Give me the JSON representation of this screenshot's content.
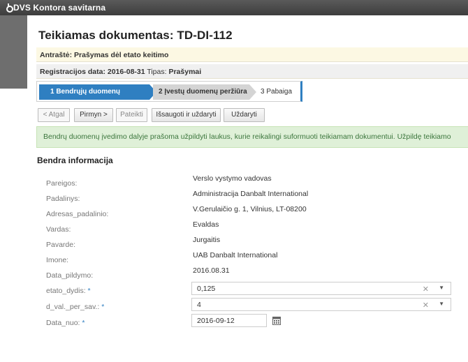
{
  "app": {
    "title": "DVS Kontora savitarna"
  },
  "document": {
    "title": "Teikiamas dokumentas: TD-DI-112"
  },
  "info": {
    "subject_label": "Antraštė:",
    "subject_value": "Prašymas dėl etato keitimo",
    "reg_label": "Registracijos data:",
    "reg_value": "2016-08-31",
    "type_label": "Tipas:",
    "type_value": "Prašymai"
  },
  "wizard": {
    "steps": [
      {
        "label": "1 Bendrųjų duomenų įvedimas",
        "state": "active"
      },
      {
        "label": "2 Įvestų duomenų peržiūra",
        "state": "pending"
      },
      {
        "label": "3 Pabaiga",
        "state": "pending"
      }
    ]
  },
  "toolbar": {
    "back": "< Atgal",
    "next": "Pirmyn >",
    "submit": "Pateikti",
    "save_close": "Išsaugoti ir uždaryti",
    "close": "Uždaryti"
  },
  "alert": "Bendrų duomenų įvedimo dalyje prašoma užpildyti laukus, kurie reikalingi suformuoti teikiamam dokumentui. Užpildę teikiamo",
  "section": {
    "title": "Bendra informacija"
  },
  "fields": [
    {
      "label": "Pareigos:",
      "value": "Verslo vystymo vadovas"
    },
    {
      "label": "Padalinys:",
      "value": "Administracija Danbalt International"
    },
    {
      "label": "Adresas_padalinio:",
      "value": "V.Gerulaičio g. 1, Vilnius, LT-08200"
    },
    {
      "label": "Vardas:",
      "value": "Evaldas"
    },
    {
      "label": "Pavarde:",
      "value": "Jurgaitis"
    },
    {
      "label": "Imone:",
      "value": "UAB Danbalt International"
    },
    {
      "label": "Data_pildymo:",
      "value": "2016.08.31"
    }
  ],
  "inputs": {
    "etato_dydis": {
      "label": "etato_dydis:",
      "value": "0,125"
    },
    "d_val_per_sav": {
      "label": "d_val._per_sav.:",
      "value": "4"
    },
    "data_nuo": {
      "label": "Data_nuo:",
      "value": "2016-09-12"
    },
    "required_mark": "*"
  },
  "icons": {
    "clear": "clear-icon",
    "caret": "chevron-down-icon",
    "calendar": "calendar-icon",
    "logo": "logo-icon"
  },
  "colors": {
    "accent": "#2f7fc1",
    "topbar": "#4a4a4a",
    "alert_bg": "#dff0d8",
    "alert_text": "#3c763d",
    "subject_bg": "#fcf8e3"
  }
}
